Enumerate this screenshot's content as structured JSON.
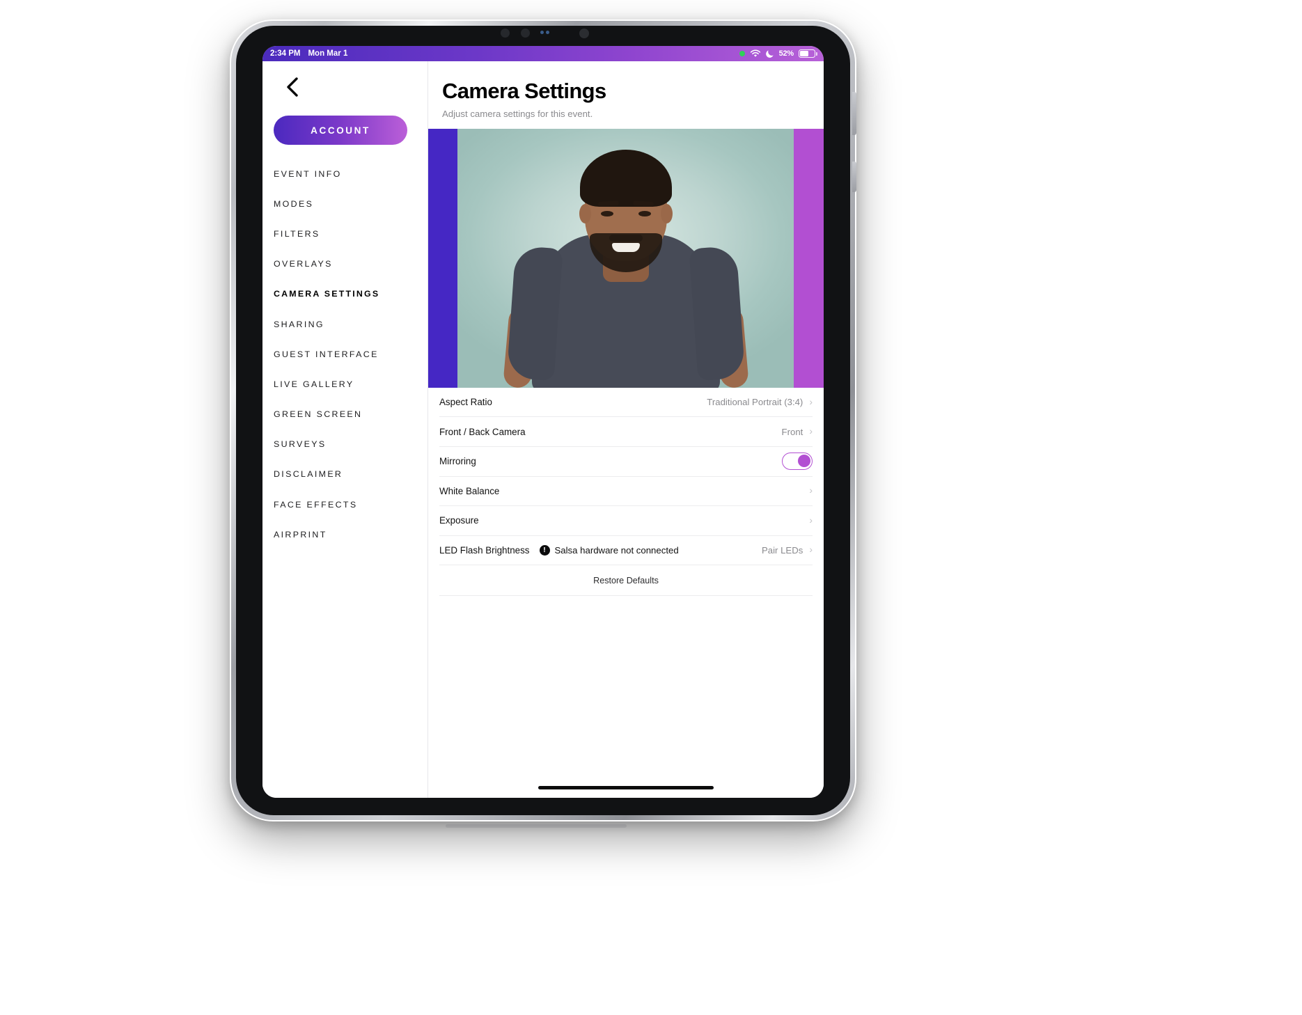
{
  "status_bar": {
    "time": "2:34 PM",
    "date": "Mon Mar 1",
    "battery_percent": "52%",
    "icons": [
      "recording-dot-icon",
      "wifi-icon",
      "do-not-disturb-moon-icon",
      "battery-icon"
    ]
  },
  "sidebar": {
    "back_icon": "chevron-left-icon",
    "account_label": "ACCOUNT",
    "items": [
      {
        "label": "EVENT INFO",
        "active": false
      },
      {
        "label": "MODES",
        "active": false
      },
      {
        "label": "FILTERS",
        "active": false
      },
      {
        "label": "OVERLAYS",
        "active": false
      },
      {
        "label": "CAMERA SETTINGS",
        "active": true
      },
      {
        "label": "SHARING",
        "active": false
      },
      {
        "label": "GUEST INTERFACE",
        "active": false
      },
      {
        "label": "LIVE GALLERY",
        "active": false
      },
      {
        "label": "GREEN SCREEN",
        "active": false
      },
      {
        "label": "SURVEYS",
        "active": false
      },
      {
        "label": "DISCLAIMER",
        "active": false
      },
      {
        "label": "FACE EFFECTS",
        "active": false
      },
      {
        "label": "AIRPRINT",
        "active": false
      }
    ]
  },
  "main": {
    "title": "Camera Settings",
    "subtitle": "Adjust camera settings for this event.",
    "preview": {
      "left_bar_color": "#4527c4",
      "right_bar_color": "#b24fd2",
      "alt": "camera-preview-portrait-of-man-in-dark-tshirt"
    },
    "rows": [
      {
        "label": "Aspect Ratio",
        "value": "Traditional Portrait (3:4)",
        "type": "disclosure"
      },
      {
        "label": "Front / Back Camera",
        "value": "Front",
        "type": "disclosure"
      },
      {
        "label": "Mirroring",
        "value": "",
        "type": "toggle",
        "toggle_on": true
      },
      {
        "label": "White Balance",
        "value": "",
        "type": "disclosure"
      },
      {
        "label": "Exposure",
        "value": "",
        "type": "disclosure"
      },
      {
        "label": "LED Flash Brightness",
        "value": "Pair LEDs",
        "type": "disclosure",
        "warning_icon": "exclamation-circle-icon",
        "warning_text": "Salsa hardware not connected"
      }
    ],
    "restore_label": "Restore Defaults"
  },
  "colors": {
    "accent_purple": "#7c39c9",
    "accent_violet": "#4b29bf",
    "accent_orchid": "#bb5fd8",
    "toggle_on": "#b24fd2"
  }
}
